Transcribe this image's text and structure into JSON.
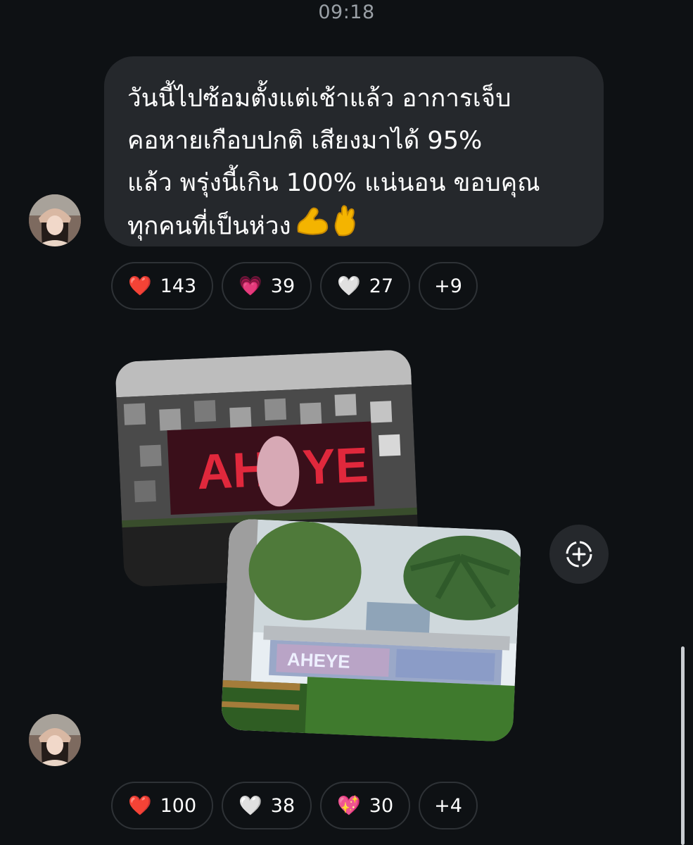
{
  "header": {
    "time": "09:18"
  },
  "message1": {
    "lines": [
      "วันนี้ไปซ้อมตั้งแต่เช้าแล้ว อาการเจ็บ",
      "คอหายเกือบปกติ เสียงมาได้ 95%",
      "แล้ว พรุ่งนี้เกิน 100% แน่นอน ขอบคุณ",
      "ทุกคนที่เป็นห่วง"
    ],
    "trailing_emojis": [
      "muscle-emoji",
      "crossed-fingers-emoji"
    ],
    "reactions": [
      {
        "emoji": "❤️",
        "icon": "red-heart-icon",
        "count": "143"
      },
      {
        "emoji": "💗",
        "icon": "pink-heart-icon",
        "count": "39"
      },
      {
        "emoji": "🤍",
        "icon": "white-heart-icon",
        "count": "27"
      }
    ],
    "more": "+9"
  },
  "message2": {
    "photos": [
      {
        "icon": "photo-billboard-night"
      },
      {
        "icon": "photo-bus-stop-banner"
      }
    ],
    "reactions": [
      {
        "emoji": "❤️",
        "icon": "red-heart-icon",
        "count": "100"
      },
      {
        "emoji": "🤍",
        "icon": "white-heart-icon",
        "count": "38"
      },
      {
        "emoji": "💖",
        "icon": "sparkling-heart-icon",
        "count": "30"
      }
    ],
    "more": "+4"
  },
  "actions": {
    "add_reaction_icon": "add-reaction-icon"
  },
  "colors": {
    "background": "#0e1114",
    "bubble": "#25282c",
    "pill_border": "#2e3236",
    "muted_text": "#9aa0a6"
  }
}
